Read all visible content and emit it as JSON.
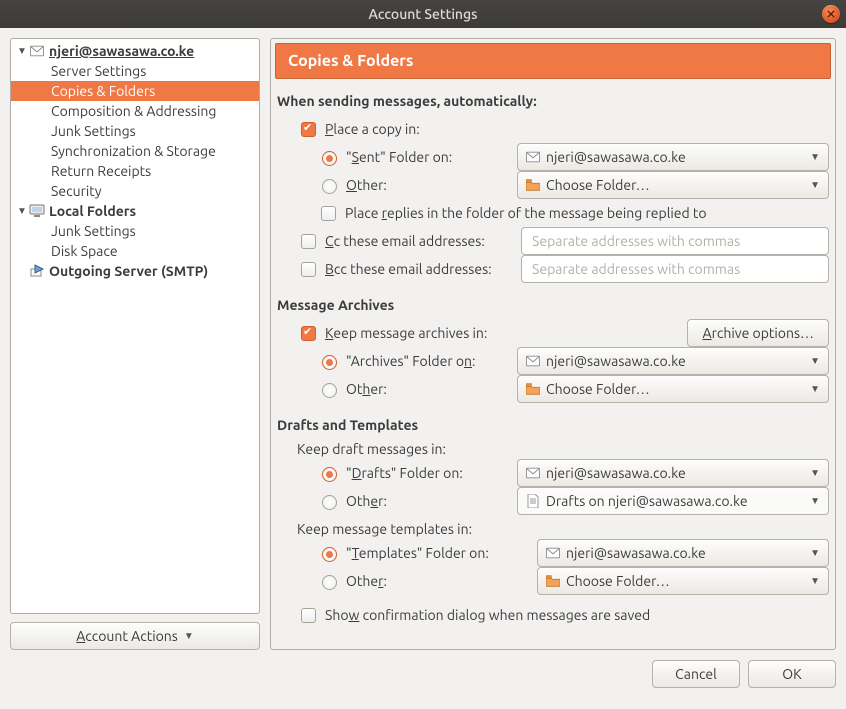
{
  "window": {
    "title": "Account Settings"
  },
  "sidebar": {
    "account_email": "njeri@sawasawa.co.ke",
    "items": [
      "Server Settings",
      "Copies & Folders",
      "Composition & Addressing",
      "Junk Settings",
      "Synchronization & Storage",
      "Return Receipts",
      "Security"
    ],
    "local_folders_label": "Local Folders",
    "local_items": [
      "Junk Settings",
      "Disk Space"
    ],
    "outgoing_label": "Outgoing Server (SMTP)",
    "account_actions_label": "Account Actions"
  },
  "panel": {
    "header": "Copies & Folders",
    "sending_heading": "When sending messages, automatically:",
    "place_copy_label": "Place a copy in:",
    "sent_folder_label": "\"Sent\" Folder on:",
    "other_label": "Other:",
    "choose_folder": "Choose Folder…",
    "account_value": "njeri@sawasawa.co.ke",
    "place_replies_label": "Place replies in the folder of the message being replied to",
    "cc_label": "Cc these email addresses:",
    "bcc_label": "Bcc these email addresses:",
    "addr_placeholder": "Separate addresses with commas",
    "archives_heading": "Message Archives",
    "keep_archives_label": "Keep message archives in:",
    "archive_options_label": "Archive options…",
    "archives_folder_label": "\"Archives\" Folder on:",
    "drafts_heading": "Drafts and Templates",
    "keep_drafts_label": "Keep draft messages in:",
    "drafts_folder_label": "\"Drafts\" Folder on:",
    "drafts_other_value": "Drafts on njeri@sawasawa.co.ke",
    "keep_templates_label": "Keep message templates in:",
    "templates_folder_label": "\"Templates\" Folder on:",
    "show_confirm_label": "Show confirmation dialog when messages are saved"
  },
  "footer": {
    "cancel": "Cancel",
    "ok": "OK"
  }
}
